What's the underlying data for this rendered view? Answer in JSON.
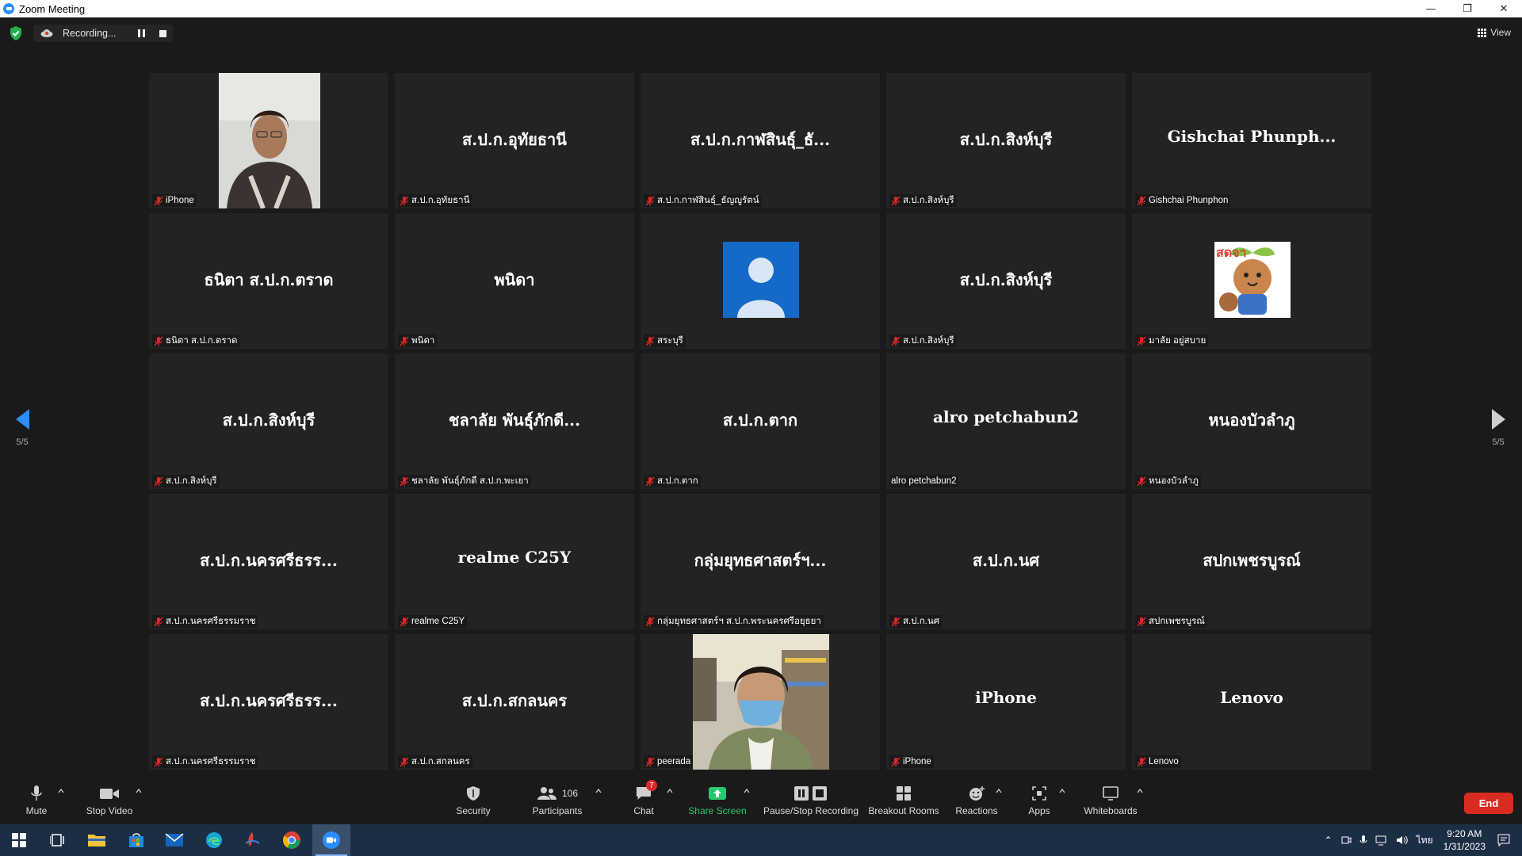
{
  "window": {
    "title": "Zoom Meeting"
  },
  "topbar": {
    "recording_label": "Recording...",
    "view_label": "View"
  },
  "pager": {
    "left_count": "5/5",
    "right_count": "5/5"
  },
  "tiles": [
    {
      "name": "",
      "label": "iPhone",
      "type": "video",
      "muted": true
    },
    {
      "name": "ส.ป.ก.อุทัยธานี",
      "label": "ส.ป.ก.อุทัยธานี",
      "type": "name",
      "muted": true
    },
    {
      "name": "ส.ป.ก.กาฬสินธุ์_ธั...",
      "label": "ส.ป.ก.กาฬสินธุ์_ธัญญูรัตน์",
      "type": "name",
      "muted": true
    },
    {
      "name": "ส.ป.ก.สิงห์บุรี",
      "label": "ส.ป.ก.สิงห์บุรี",
      "type": "name",
      "muted": true
    },
    {
      "name": "Gishchai  Phunph...",
      "label": "Gishchai Phunphon",
      "type": "name",
      "muted": true
    },
    {
      "name": "ธนิตา ส.ป.ก.ตราด",
      "label": "ธนิตา ส.ป.ก.ตราด",
      "type": "name",
      "muted": true
    },
    {
      "name": "พนิดา",
      "label": "พนิดา",
      "type": "name",
      "muted": true
    },
    {
      "name": "",
      "label": "สระบุรี",
      "type": "avatar",
      "muted": true
    },
    {
      "name": "ส.ป.ก.สิงห์บุรี",
      "label": "ส.ป.ก.สิงห์บุรี",
      "type": "name",
      "muted": true
    },
    {
      "name": "",
      "label": "มาลัย อยู่สบาย",
      "type": "sticker",
      "sticker_text": "สดจา",
      "muted": true
    },
    {
      "name": "ส.ป.ก.สิงห์บุรี",
      "label": "ส.ป.ก.สิงห์บุรี",
      "type": "name",
      "muted": true
    },
    {
      "name": "ชลาลัย  พันธุ์ภักดี...",
      "label": "ชลาลัย  พันธุ์ภักดี ส.ป.ก.พะเยา",
      "type": "name",
      "muted": true
    },
    {
      "name": "ส.ป.ก.ตาก",
      "label": "ส.ป.ก.ตาก",
      "type": "name",
      "muted": true
    },
    {
      "name": "alro petchabun2",
      "label": "alro petchabun2",
      "type": "name",
      "muted": false
    },
    {
      "name": "หนองบัวลำภู",
      "label": "หนองบัวลำภู",
      "type": "name",
      "muted": true
    },
    {
      "name": "ส.ป.ก.นครศรีธรร...",
      "label": "ส.ป.ก.นครศรีธรรมราช",
      "type": "name",
      "muted": true
    },
    {
      "name": "realme C25Y",
      "label": "realme C25Y",
      "type": "name",
      "muted": true
    },
    {
      "name": "กลุ่มยุทธศาสตร์ฯ...",
      "label": "กลุ่มยุทธศาสตร์ฯ ส.ป.ก.พระนครศรีอยุธยา",
      "type": "name",
      "muted": true
    },
    {
      "name": "ส.ป.ก.นศ",
      "label": "ส.ป.ก.นศ",
      "type": "name",
      "muted": true
    },
    {
      "name": "สปกเพชรบูรณ์",
      "label": "สปกเพชรบูรณ์",
      "type": "name",
      "muted": true
    },
    {
      "name": "ส.ป.ก.นครศรีธรร...",
      "label": "ส.ป.ก.นครศรีธรรมราช",
      "type": "name",
      "muted": true
    },
    {
      "name": "ส.ป.ก.สกลนคร",
      "label": "ส.ป.ก.สกลนคร",
      "type": "name",
      "muted": true
    },
    {
      "name": "",
      "label": "peerada",
      "type": "video2",
      "muted": true
    },
    {
      "name": "iPhone",
      "label": "iPhone",
      "type": "name",
      "muted": true
    },
    {
      "name": "Lenovo",
      "label": "Lenovo",
      "type": "name",
      "muted": true
    }
  ],
  "toolbar": {
    "mute": "Mute",
    "stop_video": "Stop Video",
    "security": "Security",
    "participants": "Participants",
    "participants_count": "106",
    "chat": "Chat",
    "chat_badge": "7",
    "share_screen": "Share Screen",
    "pause_stop_recording": "Pause/Stop Recording",
    "breakout_rooms": "Breakout Rooms",
    "reactions": "Reactions",
    "apps": "Apps",
    "whiteboards": "Whiteboards",
    "end": "End"
  },
  "taskbar": {
    "language": "ไทย",
    "time": "9:20 AM",
    "date": "1/31/2023"
  },
  "colors": {
    "accent": "#2d8cff",
    "share_green": "#27c96f",
    "end_red": "#d82c20",
    "muted_red": "#e02828"
  }
}
